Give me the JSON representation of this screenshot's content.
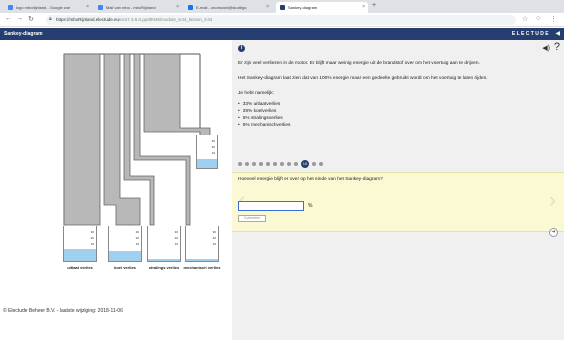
{
  "browser": {
    "tabs": [
      {
        "label": "logo mboriijnland - Google zoe",
        "color": "#4285f4"
      },
      {
        "label": "Mail van mbo - mboRijnland",
        "color": "#4285f4"
      },
      {
        "label": "E-mail - onomzoni@studbgo",
        "color": "#1a73e8"
      },
      {
        "label": "Sankey-diagram",
        "color": "#253e6f"
      }
    ],
    "url": "https://mboRijnland.electude.eu",
    "url_rest": "/ecs7.3.6.0.ga39046/module_K44_lesson_K44"
  },
  "app": {
    "title": "Sankey-diagram",
    "brand": "ELECTUDE"
  },
  "left": {
    "cylinders": [
      {
        "label": "uitlaat verlies",
        "fill": 0.33,
        "ticks": [
          "30",
          "20",
          "10"
        ]
      },
      {
        "label": "koel verlies",
        "fill": 0.29,
        "ticks": [
          "30",
          "20",
          "10"
        ]
      },
      {
        "label": "stralings verlies",
        "fill": 0.05,
        "ticks": [
          "30",
          "20",
          "10"
        ]
      },
      {
        "label": "mechanisch verlies",
        "fill": 0.05,
        "ticks": [
          "30",
          "20",
          "10"
        ]
      }
    ],
    "final_cylinder": {
      "fill": 0.28,
      "ticks": [
        "30",
        "20",
        "10"
      ]
    },
    "footer": "© Electude Beheer B.V. - laatste wijziging: 2018-11-06"
  },
  "right": {
    "intro": "Er zijn veel verliezen in de motor. Er blijft maar weinig energie uit de brandstof over om het voertuig aan te drijven.",
    "para2": "Het Sankey-diagram laat zien dat van 100% energie maar een gedeelte gebruikt wordt om het voertuig te laten rijden.",
    "para3": "Je hebt namelijk:",
    "bullets": [
      "33% uitlaatverlies",
      "29% koelverlies",
      "5% stralingsverlies",
      "5% mechanischverlies"
    ],
    "step_count": 12,
    "current_step": "10",
    "question": "Hoeveel energie blijft er over op het einde van het Sankey-diagram?",
    "answer_value": "",
    "unit": "%",
    "check_label": "Controleer",
    "next_icon": "arrow-right-icon"
  }
}
